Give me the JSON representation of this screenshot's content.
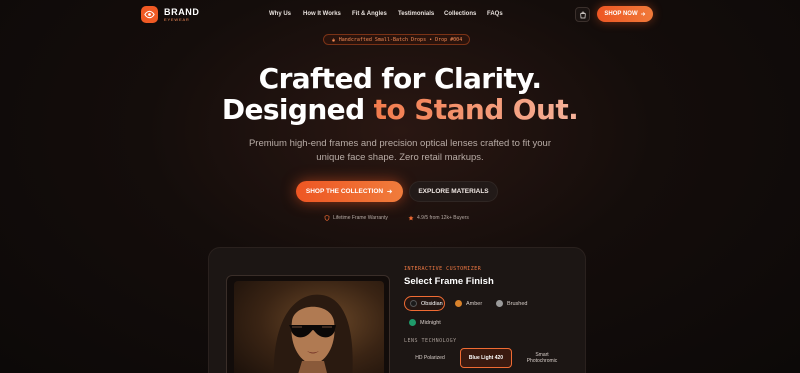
{
  "brand": {
    "name": "BRAND",
    "tagline": "EYEWEAR"
  },
  "nav": {
    "links": [
      "Why Us",
      "How It Works",
      "Fit & Angles",
      "Testimonials",
      "Collections",
      "FAQs"
    ],
    "cta": "SHOP NOW"
  },
  "hero": {
    "badge": "Handcrafted Small-Batch Drops • Drop #004",
    "title_line1": "Crafted for Clarity.",
    "title_line2_plain": "Designed ",
    "title_line2_accent": "to Stand Out.",
    "subtitle_line1": "Premium high-end frames and precision optical lenses crafted to fit your",
    "subtitle_line2": "unique face shape. Zero retail markups.",
    "primary_cta": "SHOP THE COLLECTION",
    "secondary_cta": "EXPLORE MATERIALS",
    "trust_1": "Lifetime Frame Warranty",
    "trust_2": "4.9/5 from 12k+ Buyers"
  },
  "customizer": {
    "eyebrow": "INTERACTIVE CUSTOMIZER",
    "title": "Select Frame Finish",
    "finishes": [
      {
        "label": "Obsidian",
        "color": "#1a1a1a",
        "selected": true
      },
      {
        "label": "Amber",
        "color": "#d9822b",
        "selected": false
      },
      {
        "label": "Brushed",
        "color": "#9a9a9a",
        "selected": false
      },
      {
        "label": "Midnight",
        "color": "#1f9a6a",
        "selected": false
      }
    ],
    "lens_label": "LENS TECHNOLOGY",
    "lenses": [
      {
        "label": "HD Polarized",
        "selected": false
      },
      {
        "label": "Blue Light 420",
        "selected": true
      },
      {
        "label": "Smart Photochromic",
        "selected": false
      }
    ]
  },
  "colors": {
    "accent": "#f05a24",
    "background": "#0e0a09"
  }
}
